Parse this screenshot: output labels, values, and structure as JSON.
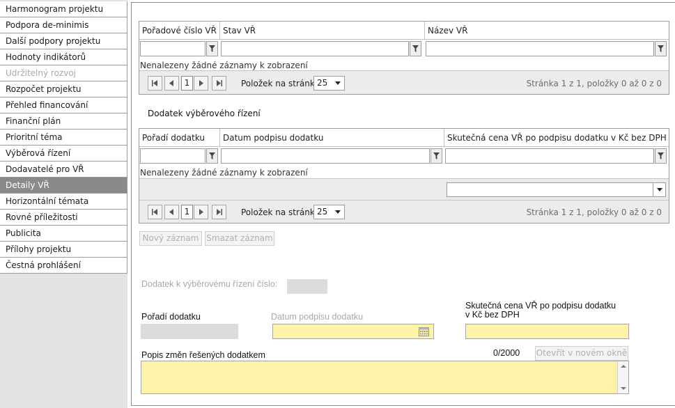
{
  "sidebar": {
    "items": [
      {
        "label": "Harmonogram projektu",
        "state": "normal"
      },
      {
        "label": "Podpora de-minimis",
        "state": "normal"
      },
      {
        "label": "Další podpory projektu",
        "state": "normal"
      },
      {
        "label": "Hodnoty indikátorů",
        "state": "normal"
      },
      {
        "label": "Udržitelný rozvoj",
        "state": "disabled"
      },
      {
        "label": "Rozpočet projektu",
        "state": "normal"
      },
      {
        "label": "Přehled financování",
        "state": "normal"
      },
      {
        "label": "Finanční plán",
        "state": "normal"
      },
      {
        "label": "Prioritní téma",
        "state": "normal"
      },
      {
        "label": "Výběrová řízení",
        "state": "normal"
      },
      {
        "label": "Dodavatelé pro VŘ",
        "state": "normal"
      },
      {
        "label": "Detaily VŘ",
        "state": "active"
      },
      {
        "label": "Horizontální témata",
        "state": "normal"
      },
      {
        "label": "Rovné příležitosti",
        "state": "normal"
      },
      {
        "label": "Publicita",
        "state": "normal"
      },
      {
        "label": "Přílohy projektu",
        "state": "normal"
      },
      {
        "label": "Čestná prohlášení",
        "state": "normal"
      }
    ]
  },
  "grid1": {
    "columns": [
      "Pořadové číslo VŘ",
      "Stav VŘ",
      "Název VŘ"
    ],
    "empty_message": "Nenalezeny žádné záznamy k zobrazení",
    "pager": {
      "page": "1",
      "per_page_label": "Položek na stránku",
      "per_page": "25",
      "info": "Stránka 1 z 1, položky 0 až 0 z 0"
    }
  },
  "section_title": "Dodatek výběrového řízení",
  "grid2": {
    "columns": [
      "Pořadí dodatku",
      "Datum podpisu dodatku",
      "Skutečná cena VŘ po podpisu dodatku v Kč bez DPH"
    ],
    "empty_message": "Nenalezeny žádné záznamy k zobrazení",
    "pager": {
      "page": "1",
      "per_page_label": "Položek na stránku",
      "per_page": "25",
      "info": "Stránka 1 z 1, položky 0 až 0 z 0"
    }
  },
  "buttons": {
    "new_record": "Nový záznam",
    "delete_record": "Smazat záznam",
    "open_new_window": "Otevřít v novém okně"
  },
  "form": {
    "amendment_number_label": "Dodatek k výběrovému řízení číslo:",
    "order_label": "Pořadí dodatku",
    "date_label": "Datum podpisu dodatku",
    "price_label_line1": "Skutečná cena VŘ po podpisu dodatku",
    "price_label_line2": "v Kč bez DPH",
    "description_label": "Popis změn řešených dodatkem",
    "char_counter": "0/2000"
  },
  "colors": {
    "active_nav": "#8a8a8a",
    "required_field": "#fdf3a8",
    "readonly_field": "#dcdcdc"
  }
}
